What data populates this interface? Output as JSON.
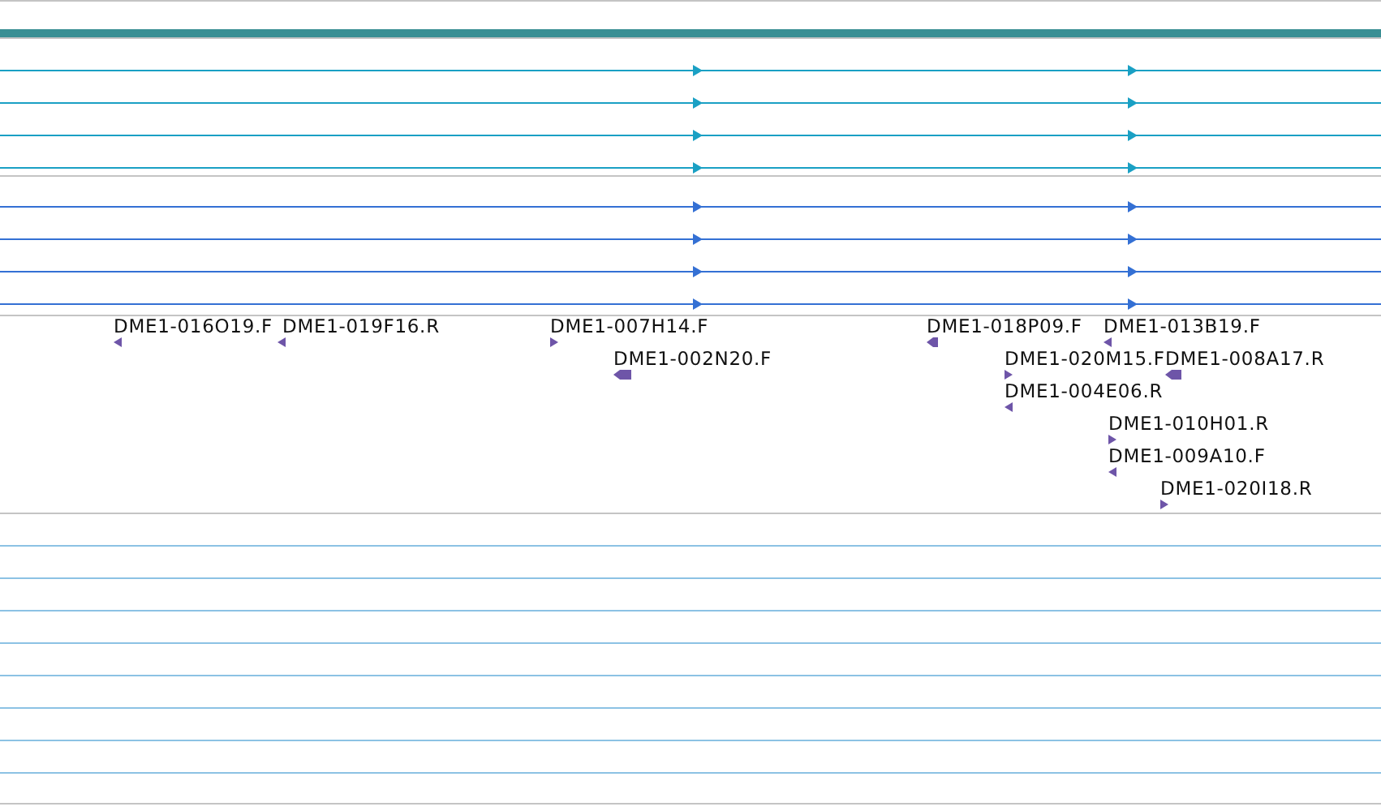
{
  "tracks": [
    {
      "color": "#1aa0c4"
    },
    {
      "color": "#1aa0c4"
    },
    {
      "color": "#1aa0c4"
    },
    {
      "color": "#1aa0c4"
    },
    {
      "color": "#3470d4"
    },
    {
      "color": "#3470d4"
    },
    {
      "color": "#3470d4"
    },
    {
      "color": "#3470d4"
    }
  ],
  "features": [
    {
      "label": "DME1-016O19.F",
      "reverse": true
    },
    {
      "label": "DME1-019F16.R",
      "reverse": true
    },
    {
      "label": "DME1-007H14.F",
      "reverse": false
    },
    {
      "label": "DME1-018P09.F",
      "reverse": true
    },
    {
      "label": "DME1-013B19.F",
      "reverse": true
    },
    {
      "label": "DME1-002N20.F",
      "reverse": true
    },
    {
      "label": "DME1-020M15.F",
      "reverse": false
    },
    {
      "label": "DME1-008A17.R",
      "reverse": true
    },
    {
      "label": "DME1-004E06.R",
      "reverse": true
    },
    {
      "label": "DME1-010H01.R",
      "reverse": false
    },
    {
      "label": "DME1-009A10.F",
      "reverse": true
    },
    {
      "label": "DME1-020I18.R",
      "reverse": false
    }
  ]
}
